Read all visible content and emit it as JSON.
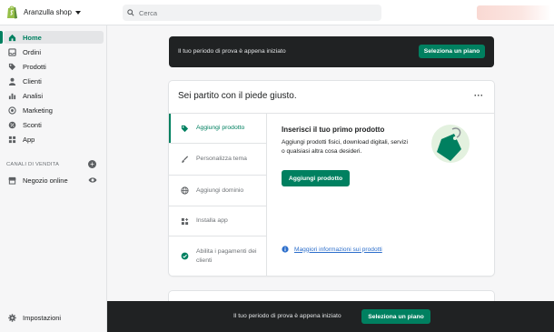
{
  "header": {
    "shop_name": "Aranzulla shop",
    "search_placeholder": "Cerca"
  },
  "sidebar": {
    "items": [
      {
        "label": "Home",
        "icon": "home-icon",
        "active": true
      },
      {
        "label": "Ordini",
        "icon": "orders-icon"
      },
      {
        "label": "Prodotti",
        "icon": "tag-icon"
      },
      {
        "label": "Clienti",
        "icon": "person-icon"
      },
      {
        "label": "Analisi",
        "icon": "bar-chart-icon"
      },
      {
        "label": "Marketing",
        "icon": "target-icon"
      },
      {
        "label": "Sconti",
        "icon": "discount-icon"
      },
      {
        "label": "App",
        "icon": "apps-icon"
      }
    ],
    "sales_channels_title": "CANALI DI VENDITA",
    "online_store_label": "Negozio online",
    "settings_label": "Impostazioni"
  },
  "trial_banner": {
    "text": "Il tuo periodo di prova è appena iniziato",
    "button_label": "Seleziona un piano"
  },
  "setup_card": {
    "title": "Sei partito con il piede giusto.",
    "more_label": "···",
    "tabs": [
      {
        "label": "Aggiungi prodotto",
        "icon": "tag-icon",
        "active": true
      },
      {
        "label": "Personalizza tema",
        "icon": "brush-icon"
      },
      {
        "label": "Aggiungi dominio",
        "icon": "globe-icon"
      },
      {
        "label": "Installa app",
        "icon": "apps-icon"
      },
      {
        "label": "Abilita i pagamenti dei clienti",
        "icon": "check-circle-icon"
      }
    ],
    "pane_title": "Inserisci il tuo primo prodotto",
    "pane_description": "Aggiungi prodotti fisici, download digitali, servizi o qualsiasi altra cosa desideri.",
    "add_button_label": "Aggiungi prodotto",
    "more_info_link": "Maggiori informazioni sui prodotti"
  },
  "bottom_bar": {
    "text": "Il tuo periodo di prova è appena iniziato",
    "button_label": "Seleziona un piano"
  },
  "colors": {
    "accent": "#008060",
    "dark": "#202223",
    "link": "#2c6ecb"
  }
}
